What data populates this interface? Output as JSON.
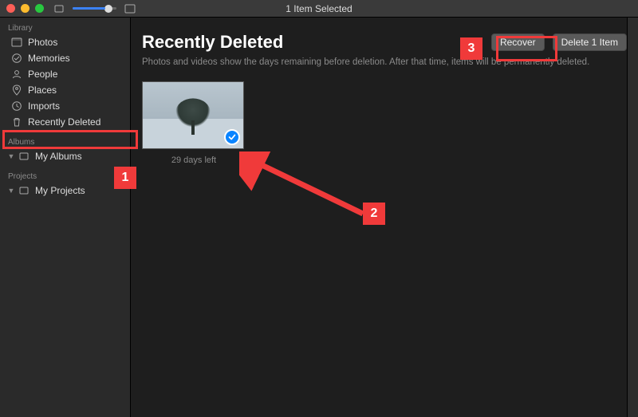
{
  "titlebar": {
    "text": "1 Item Selected"
  },
  "sidebar": {
    "library_header": "Library",
    "library": [
      {
        "label": "Photos"
      },
      {
        "label": "Memories"
      },
      {
        "label": "People"
      },
      {
        "label": "Places"
      },
      {
        "label": "Imports"
      },
      {
        "label": "Recently Deleted"
      }
    ],
    "albums_header": "Albums",
    "albums": [
      {
        "label": "My Albums"
      }
    ],
    "projects_header": "Projects",
    "projects": [
      {
        "label": "My Projects"
      }
    ]
  },
  "main": {
    "title": "Recently Deleted",
    "subtitle": "Photos and videos show the days remaining before deletion. After that time, items will be permanently deleted.",
    "recover_label": "Recover",
    "delete_label": "Delete 1 Item",
    "items": [
      {
        "caption": "29 days left",
        "selected": true
      }
    ]
  },
  "annotations": {
    "n1": "1",
    "n2": "2",
    "n3": "3"
  }
}
